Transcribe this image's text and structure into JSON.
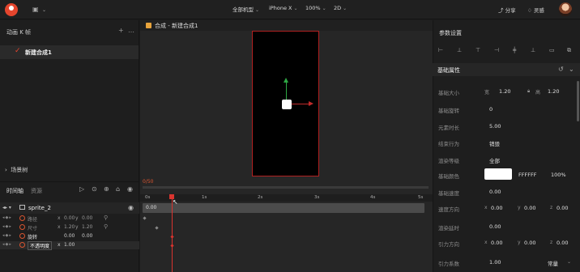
{
  "topbar": {
    "device_model": "全部机型",
    "device": "iPhone X",
    "zoom": "100%",
    "mode": "2D",
    "share_label": "分享",
    "inspiration_label": "灵感"
  },
  "left_panel": {
    "anim_title": "动画 K 帧",
    "add_icon": "+",
    "more_icon": "…",
    "composition": "新建合成1",
    "scene_tree": "场景树"
  },
  "timeline": {
    "tab_timeline": "时间轴",
    "tab_resource": "资源",
    "current_time": "0/50",
    "ruler": [
      "0s",
      "1s",
      "2s",
      "3s",
      "4s",
      "5s"
    ],
    "track_value": "0.00",
    "sprite_name": "sprite_2",
    "props": [
      {
        "name": "路径",
        "x_label": "x",
        "x": "0.00",
        "y_label": "y",
        "y": "0.00"
      },
      {
        "name": "尺寸",
        "x_label": "x",
        "x": "1.20",
        "y_label": "y",
        "y": "1.20"
      },
      {
        "name": "旋转",
        "x_label": "",
        "x": "0.00",
        "y_label": "",
        "y": "0.00"
      },
      {
        "name": "不透明度",
        "x_label": "x",
        "x": "1.00",
        "y_label": "",
        "y": ""
      }
    ]
  },
  "center": {
    "tab_title": "合成 - 新建合成1"
  },
  "right_panel": {
    "title": "参数设置",
    "section": "基础属性",
    "rows": [
      {
        "label": "基础大小",
        "k1": "宽",
        "v1": "1.20",
        "k2": "高",
        "v2": "1.20"
      },
      {
        "label": "基础旋转",
        "v1": "0"
      },
      {
        "label": "元素时长",
        "v1": "5.00"
      },
      {
        "label": "结束行为",
        "v1": "销毁"
      },
      {
        "label": "渲染等级",
        "v1": "全部"
      },
      {
        "label": "基础颜色",
        "v1": "FFFFFF",
        "v2": "100%"
      },
      {
        "label": "基础速度",
        "v1": "0.00"
      },
      {
        "label": "速度方向",
        "k1": "x",
        "v1": "0.00",
        "k2": "y",
        "v2": "0.00",
        "k3": "z",
        "v3": "0.00"
      },
      {
        "label": "渲染延时",
        "v1": "0.00"
      },
      {
        "label": "引力方向",
        "k1": "x",
        "v1": "0.00",
        "k2": "y",
        "v2": "0.00",
        "k3": "z",
        "v3": "0.00"
      },
      {
        "label": "引力系数",
        "v1": "1.00",
        "v2": "常量"
      }
    ]
  },
  "colors": {
    "accent": "#e5452d",
    "playhead": "#d9342f",
    "gizmo_y": "#2ea844",
    "gizmo_x": "#c02a2a",
    "canvas_border": "#b02020"
  }
}
